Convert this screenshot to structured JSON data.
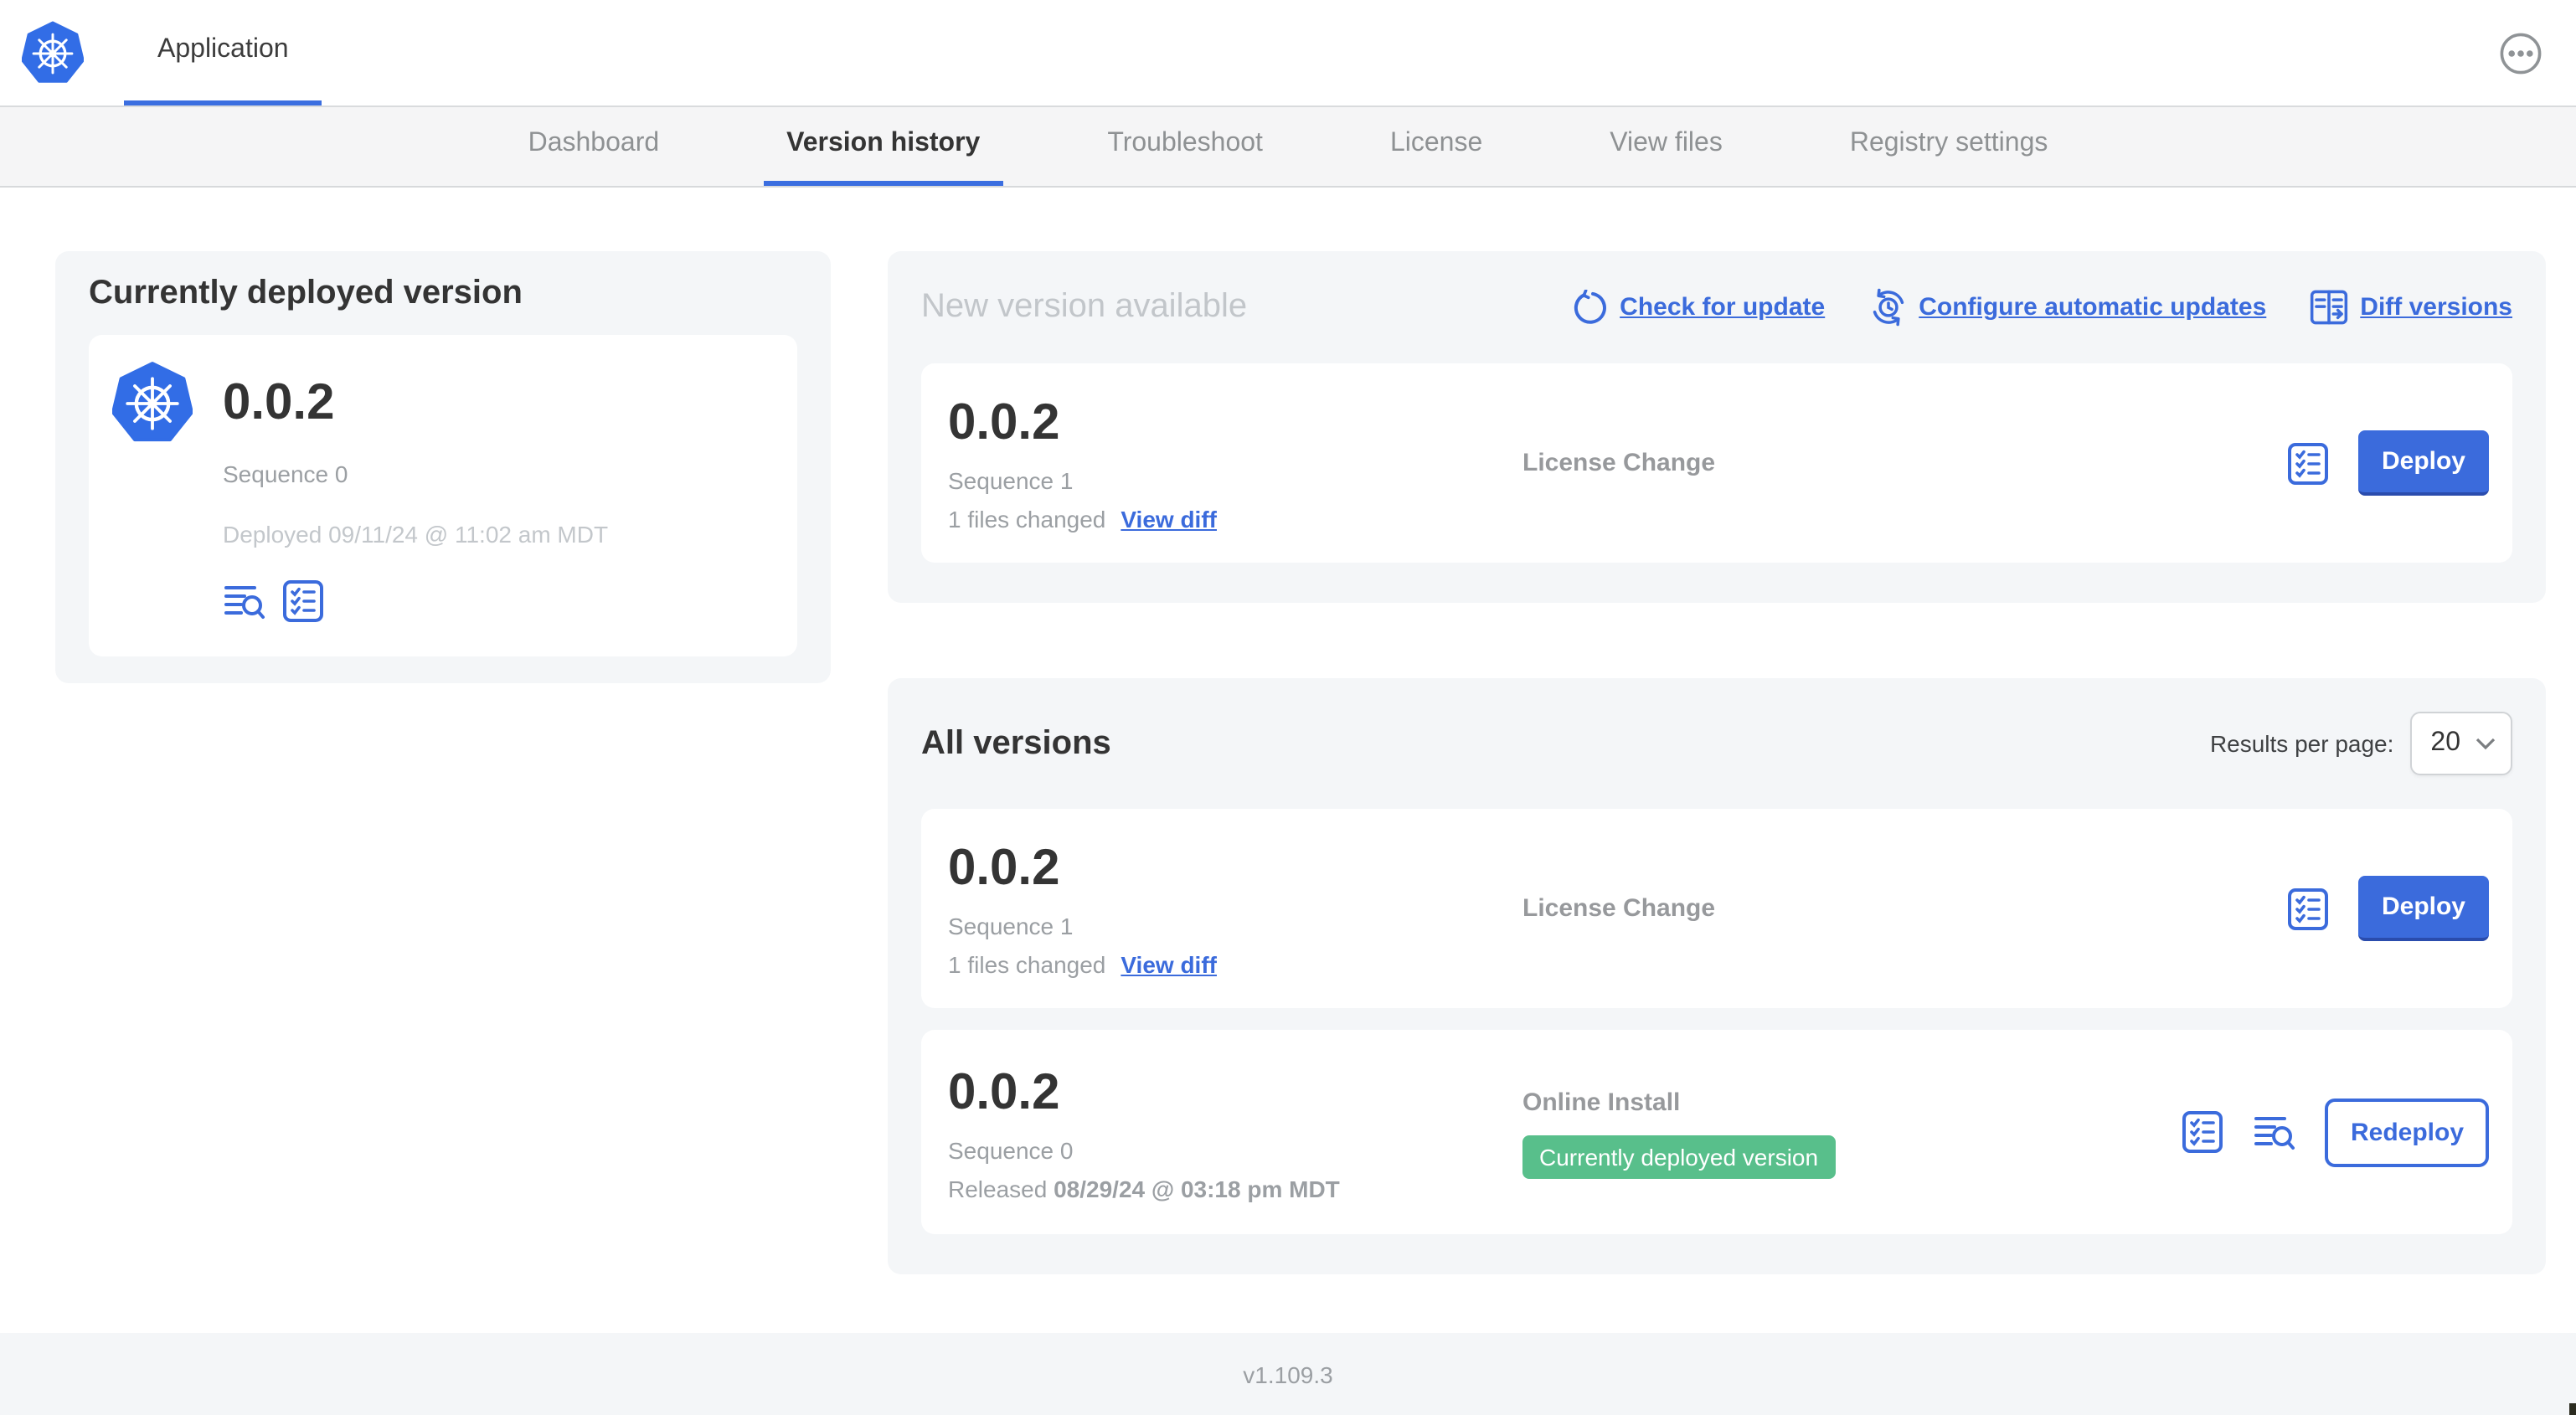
{
  "header": {
    "app_label": "Application"
  },
  "nav": {
    "tabs": [
      {
        "label": "Dashboard",
        "active": false
      },
      {
        "label": "Version history",
        "active": true
      },
      {
        "label": "Troubleshoot",
        "active": false
      },
      {
        "label": "License",
        "active": false
      },
      {
        "label": "View files",
        "active": false
      },
      {
        "label": "Registry settings",
        "active": false
      }
    ]
  },
  "current_version": {
    "title": "Currently deployed version",
    "version": "0.0.2",
    "sequence": "Sequence 0",
    "deployed": "Deployed 09/11/24 @ 11:02 am MDT",
    "icons": [
      "deploy-logs-icon",
      "preflight-checks-icon"
    ]
  },
  "new_version": {
    "title": "New version available",
    "actions": [
      {
        "label": "Check for update",
        "icon": "refresh-icon"
      },
      {
        "label": "Configure automatic updates",
        "icon": "scheduled-update-icon"
      },
      {
        "label": "Diff versions",
        "icon": "diff-icon"
      }
    ],
    "card": {
      "version": "0.0.2",
      "sequence": "Sequence 1",
      "files_changed": "1 files changed",
      "view_diff_label": "View diff",
      "source": "License Change",
      "action_label": "Deploy"
    }
  },
  "all_versions": {
    "title": "All versions",
    "results_per_page_label": "Results per page:",
    "results_per_page_value": "20",
    "rows": [
      {
        "version": "0.0.2",
        "sequence": "Sequence 1",
        "files_changed": "1 files changed",
        "view_diff_label": "View diff",
        "source": "License Change",
        "action_label": "Deploy"
      },
      {
        "version": "0.0.2",
        "sequence": "Sequence 0",
        "released_prefix": "Released",
        "released_date": "08/29/24 @ 03:18 pm MDT",
        "source": "Online Install",
        "badge": "Currently deployed version",
        "action_label": "Redeploy"
      }
    ]
  },
  "footer": {
    "app_version": "v1.109.3"
  },
  "colors": {
    "accent_blue": "#3B6BDC",
    "k8s_blue": "#326DE6",
    "success_green": "#58BF8B",
    "section_bg": "#F4F6F8",
    "muted_text": "#9B9FA3",
    "light_text": "#C3C7CB"
  }
}
